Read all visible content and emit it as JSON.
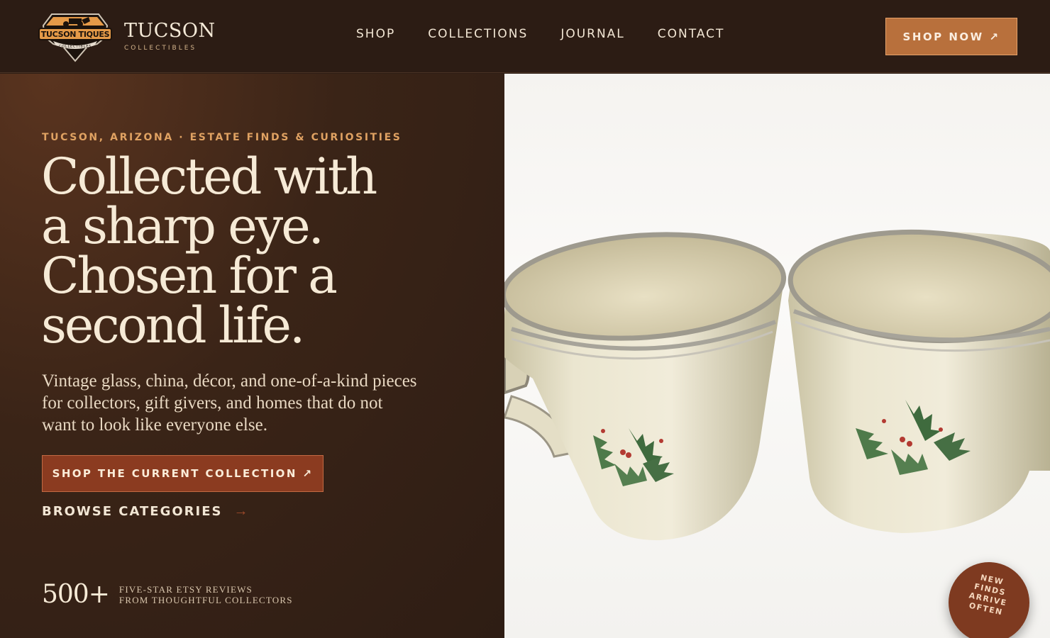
{
  "brand": {
    "badge_text": "TUCSON TIQUES",
    "badge_sub": "COLLECTIBLES",
    "name": "TUCSON",
    "tagline": "COLLECTIBLES"
  },
  "nav": {
    "items": [
      {
        "label": "SHOP"
      },
      {
        "label": "COLLECTIONS"
      },
      {
        "label": "JOURNAL"
      },
      {
        "label": "CONTACT"
      }
    ],
    "cta_label": "SHOP NOW ↗"
  },
  "hero": {
    "eyebrow": "TUCSON, ARIZONA · ESTATE FINDS & CURIOSITIES",
    "headline_lines": [
      "Collected with",
      "a sharp eye.",
      "Chosen for a",
      "second life."
    ],
    "lede": "Vintage glass, china, décor, and one-of-a-kind pieces for collectors, gift givers, and homes that do not want to look like everyone else.",
    "primary_cta": "SHOP THE CURRENT COLLECTION ↗",
    "secondary_cta": "BROWSE CATEGORIES",
    "stat_number": "500+",
    "stat_line1": "FIVE-STAR ETSY REVIEWS",
    "stat_line2": "FROM THOUGHTFUL COLLECTORS"
  },
  "stamp": {
    "line1": "NEW FINDS",
    "line2": "ARRIVE",
    "line3": "OFTEN"
  },
  "colors": {
    "header_bg": "#2c1c14",
    "accent": "#b8703c",
    "primary_cta_bg": "#8b3b20",
    "eyebrow": "#e0a262",
    "cream": "#f6ead6"
  }
}
